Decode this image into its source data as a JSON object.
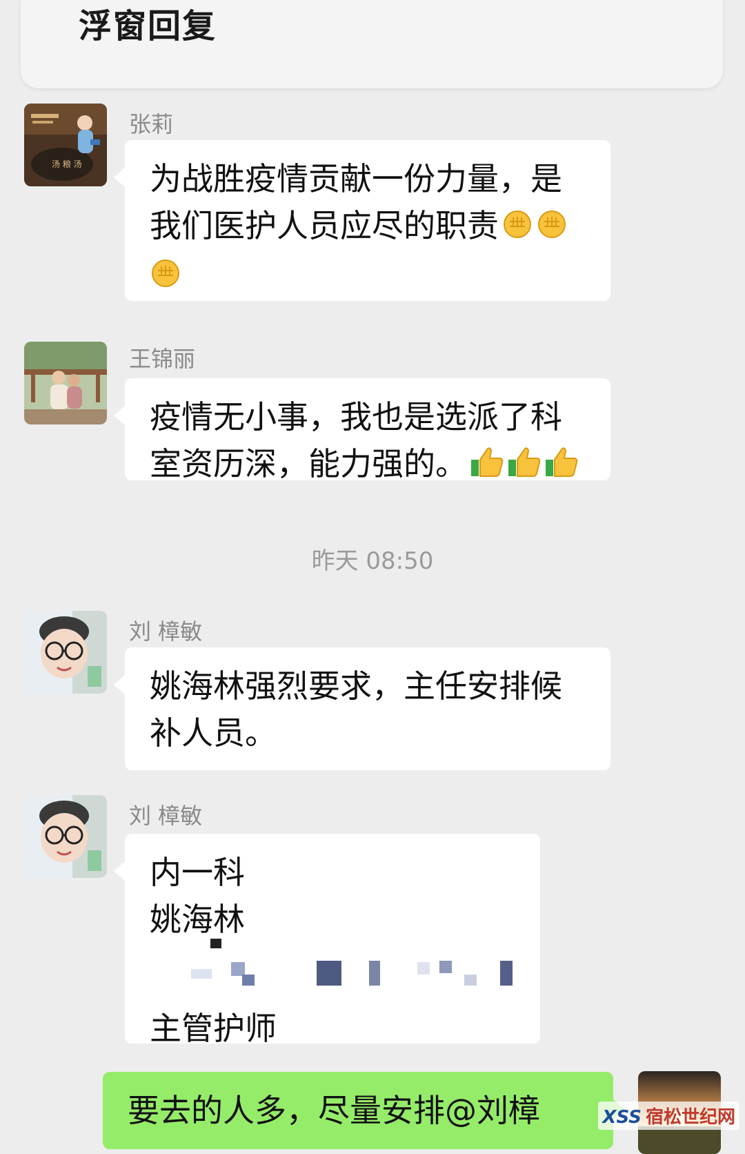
{
  "float_panel": {
    "title": "浮窗回复"
  },
  "messages": [
    {
      "sender": "张莉",
      "lines": [
        "为战胜疫情贡献一份力量，是",
        "我们医护人员应尽的职责"
      ],
      "emoji": "fist-emoji"
    },
    {
      "sender": "王锦丽",
      "lines": [
        "疫情无小事，我也是选派了科",
        "室资历深，能力强的。"
      ],
      "emoji": "thumbs-up-emoji"
    },
    {
      "sender": "刘 樟敏",
      "lines": [
        "姚海林强烈要求，主任安排候",
        "补人员。"
      ]
    },
    {
      "sender": "刘 樟敏",
      "lines": [
        "内一科",
        "姚海林",
        "主管护师"
      ]
    },
    {
      "sender": "self",
      "lines": [
        "要去的人多，尽量安排@刘樟"
      ]
    }
  ],
  "timestamp": "昨天 08:50",
  "watermark": {
    "logo": "XSS",
    "text": "宿松世纪网"
  },
  "colors": {
    "background": "#ededed",
    "bubble_incoming": "#ffffff",
    "bubble_outgoing": "#95ec69"
  }
}
